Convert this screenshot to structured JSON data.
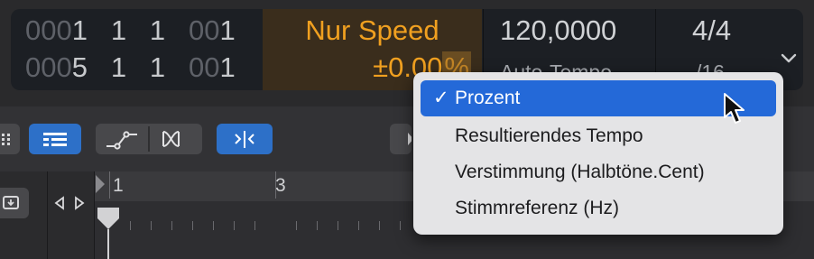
{
  "lcd": {
    "position": {
      "row1_dim": "000",
      "row1_bar": "1",
      "row1_beat": "1",
      "row1_div": "1",
      "row1_tick_dim": "00",
      "row1_tick": "1",
      "row2_dim": "000",
      "row2_bar": "5",
      "row2_beat": "1",
      "row2_div": "1",
      "row2_tick_dim": "00",
      "row2_tick": "1"
    },
    "speed": {
      "mode": "Nur Speed",
      "value": "±0.00",
      "unit": "%"
    },
    "tempo": {
      "value": "120,0000",
      "mode": "Auto-Tempo"
    },
    "signature": {
      "time": "4/4",
      "division": "/16"
    }
  },
  "ruler": {
    "bars": [
      "1",
      "3"
    ]
  },
  "menu": {
    "items": [
      {
        "label": "Prozent",
        "checked": true
      },
      {
        "label": "Resultierendes Tempo",
        "checked": false
      },
      {
        "label": "Verstimmung (Halbtöne.Cent)",
        "checked": false
      },
      {
        "label": "Stimmreferenz (Hz)",
        "checked": false
      }
    ],
    "check_glyph": "✓"
  },
  "colors": {
    "accent": "#2469d8",
    "speed_orange": "#f0a020"
  }
}
